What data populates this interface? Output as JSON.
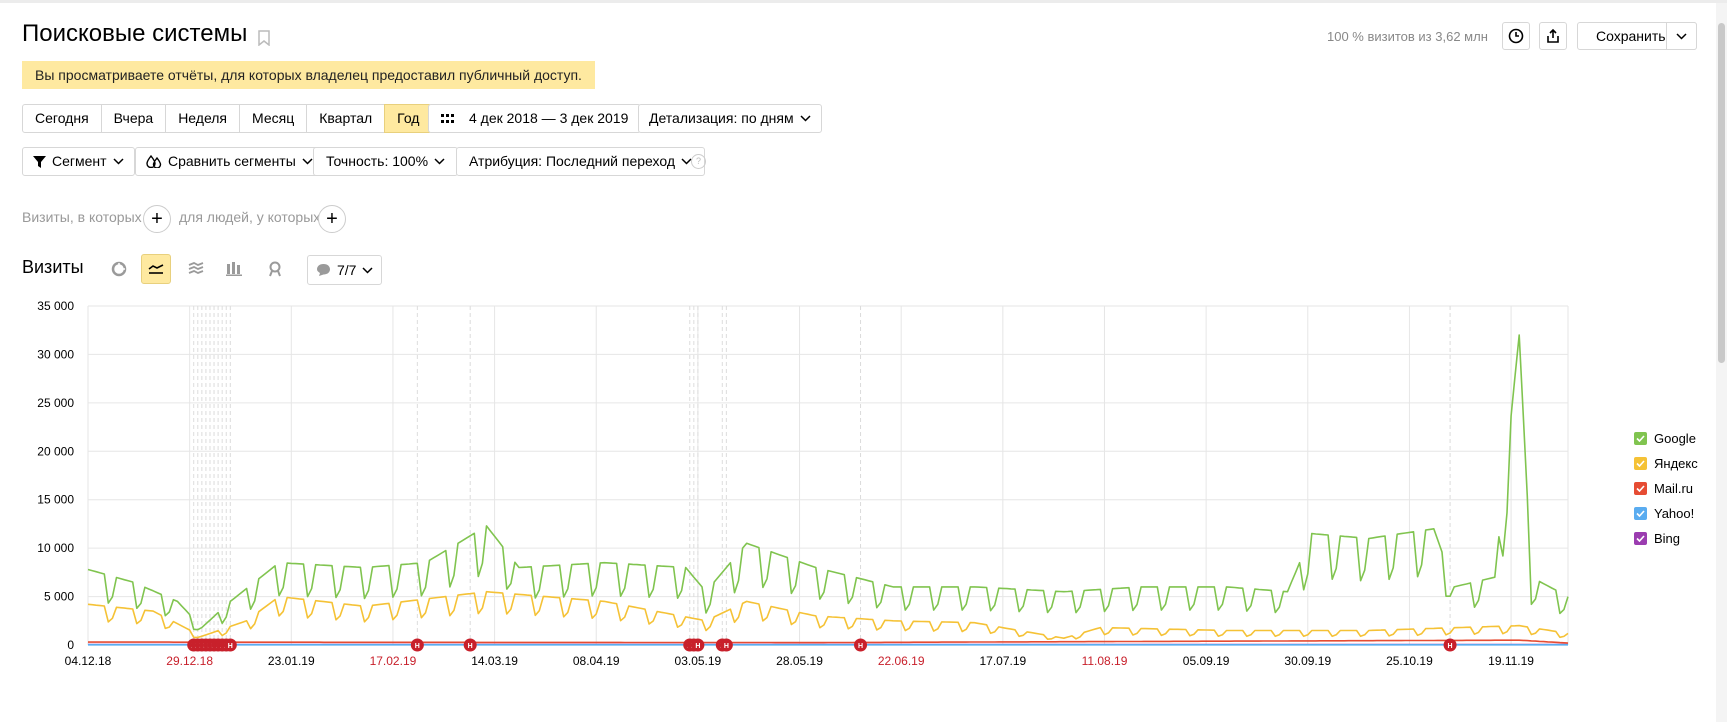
{
  "title": "Поисковые системы",
  "visits_share": "100 % визитов из 3,62 млн",
  "toolbar": {
    "save_label": "Сохранить"
  },
  "notice": "Вы просматриваете отчёты, для которых владелец предоставил публичный доступ.",
  "periods": [
    "Сегодня",
    "Вчера",
    "Неделя",
    "Месяц",
    "Квартал",
    "Год"
  ],
  "active_period": "Год",
  "date_range": "4 дек 2018 — 3 дек 2019",
  "detail": "Детализация: по дням",
  "filters": {
    "segment": "Сегмент",
    "compare": "Сравнить сегменты",
    "accuracy": "Точность: 100%",
    "attribution": "Атрибуция: Последний переход",
    "help": "?"
  },
  "conditions": {
    "visits_where": "Визиты, в которых",
    "people_where": "для людей, у которых"
  },
  "chart_section": {
    "title": "Визиты",
    "annotations": "7/7"
  },
  "icons": [
    "bookmark-icon",
    "clock-icon",
    "share-icon",
    "chevron-down-icon",
    "calendar-grid-icon",
    "funnel-icon",
    "drops-icon",
    "pie-chart-icon",
    "line-chart-icon",
    "area-chart-icon",
    "bar-chart-icon",
    "map-icon",
    "comment-icon",
    "plus-icon"
  ],
  "colors": {
    "Google": "#80c44f",
    "Яндекс": "#f5c236",
    "Mail.ru": "#e64c33",
    "Yahoo!": "#5aacf0",
    "Bing": "#9b3db0",
    "holiday": "#c8202b",
    "accent": "#fee9a0"
  },
  "chart_data": {
    "type": "line",
    "title": "",
    "xlabel": "",
    "ylabel": "",
    "ylim": [
      0,
      35000
    ],
    "yticks": [
      "35 000",
      "30 000",
      "25 000",
      "20 000",
      "15 000",
      "10 000",
      "5 000",
      "0"
    ],
    "yticks_values": [
      35000,
      30000,
      25000,
      20000,
      15000,
      10000,
      5000,
      0
    ],
    "xticks": [
      {
        "label": "04.12.18",
        "holiday": false
      },
      {
        "label": "29.12.18",
        "holiday": true
      },
      {
        "label": "23.01.19",
        "holiday": false
      },
      {
        "label": "17.02.19",
        "holiday": true
      },
      {
        "label": "14.03.19",
        "holiday": false
      },
      {
        "label": "08.04.19",
        "holiday": false
      },
      {
        "label": "03.05.19",
        "holiday": false
      },
      {
        "label": "28.05.19",
        "holiday": false
      },
      {
        "label": "22.06.19",
        "holiday": true
      },
      {
        "label": "17.07.19",
        "holiday": false
      },
      {
        "label": "11.08.19",
        "holiday": true
      },
      {
        "label": "05.09.19",
        "holiday": false
      },
      {
        "label": "30.09.19",
        "holiday": false
      },
      {
        "label": "25.10.19",
        "holiday": false
      },
      {
        "label": "19.11.19",
        "holiday": false
      }
    ],
    "grid": true,
    "legend_position": "right",
    "series": [
      {
        "name": "Google",
        "keypoints": [
          [
            "2018-12-04",
            7800
          ],
          [
            "2018-12-15",
            6500
          ],
          [
            "2018-12-26",
            4500
          ],
          [
            "2019-01-01",
            1800
          ],
          [
            "2019-01-08",
            4500
          ],
          [
            "2019-01-20",
            8500
          ],
          [
            "2019-02-10",
            8000
          ],
          [
            "2019-02-25",
            8500
          ],
          [
            "2019-03-05",
            10500
          ],
          [
            "2019-03-12",
            12300
          ],
          [
            "2019-03-20",
            8000
          ],
          [
            "2019-04-10",
            8500
          ],
          [
            "2019-04-30",
            8000
          ],
          [
            "2019-05-05",
            5500
          ],
          [
            "2019-05-15",
            10500
          ],
          [
            "2019-06-01",
            8000
          ],
          [
            "2019-06-20",
            6000
          ],
          [
            "2019-07-10",
            6000
          ],
          [
            "2019-08-01",
            5500
          ],
          [
            "2019-08-20",
            6000
          ],
          [
            "2019-09-10",
            6000
          ],
          [
            "2019-09-25",
            5500
          ],
          [
            "2019-10-01",
            11500
          ],
          [
            "2019-10-15",
            11000
          ],
          [
            "2019-10-31",
            12000
          ],
          [
            "2019-11-05",
            6000
          ],
          [
            "2019-11-15",
            7000
          ],
          [
            "2019-11-21",
            32000
          ],
          [
            "2019-11-24",
            7000
          ],
          [
            "2019-12-03",
            5000
          ]
        ]
      },
      {
        "name": "Яндекс",
        "keypoints": [
          [
            "2018-12-04",
            4200
          ],
          [
            "2018-12-20",
            3500
          ],
          [
            "2019-01-01",
            900
          ],
          [
            "2019-01-12",
            2500
          ],
          [
            "2019-01-20",
            5000
          ],
          [
            "2019-02-10",
            4000
          ],
          [
            "2019-03-12",
            5500
          ],
          [
            "2019-04-10",
            4500
          ],
          [
            "2019-05-05",
            2500
          ],
          [
            "2019-05-15",
            4500
          ],
          [
            "2019-06-01",
            3000
          ],
          [
            "2019-06-20",
            2500
          ],
          [
            "2019-07-10",
            2300
          ],
          [
            "2019-08-01",
            700
          ],
          [
            "2019-08-10",
            1800
          ],
          [
            "2019-09-10",
            1500
          ],
          [
            "2019-10-15",
            1500
          ],
          [
            "2019-11-21",
            2000
          ],
          [
            "2019-12-03",
            1200
          ]
        ]
      },
      {
        "name": "Mail.ru",
        "keypoints": [
          [
            "2018-12-04",
            300
          ],
          [
            "2019-06-01",
            250
          ],
          [
            "2019-11-21",
            500
          ],
          [
            "2019-12-03",
            200
          ]
        ]
      },
      {
        "name": "Yahoo!",
        "keypoints": [
          [
            "2018-12-04",
            20
          ],
          [
            "2019-12-03",
            20
          ]
        ]
      },
      {
        "name": "Bing",
        "keypoints": [
          [
            "2018-12-04",
            40
          ],
          [
            "2019-12-03",
            40
          ]
        ]
      }
    ],
    "holiday_markers": [
      "2018-12-30",
      "2018-12-31",
      "2019-01-01",
      "2019-01-02",
      "2019-01-03",
      "2019-01-04",
      "2019-01-05",
      "2019-01-06",
      "2019-01-07",
      "2019-01-08",
      "2019-02-23",
      "2019-03-08",
      "2019-05-01",
      "2019-05-02",
      "2019-05-03",
      "2019-05-09",
      "2019-05-10",
      "2019-06-12",
      "2019-11-04"
    ],
    "x_range": [
      "2018-12-04",
      "2019-12-03"
    ]
  }
}
